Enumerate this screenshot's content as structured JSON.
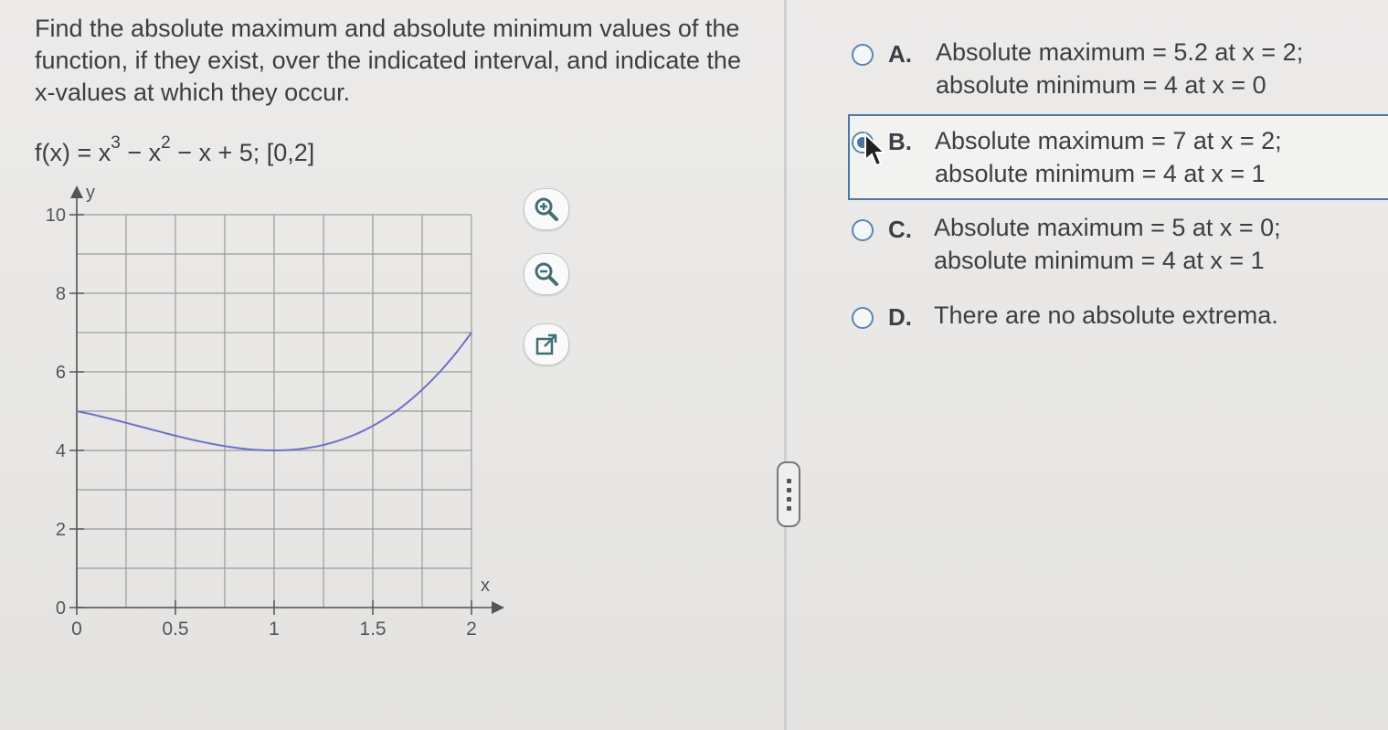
{
  "question": {
    "prompt": "Find the absolute maximum and absolute minimum values of the function, if they exist, over the indicated interval, and indicate the x-values at which they occur.",
    "formula_prefix": "f(x) = x",
    "formula_exp1": "3",
    "formula_mid": " − x",
    "formula_exp2": "2",
    "formula_suffix": " − x + 5; [0,2]"
  },
  "graph": {
    "y_axis_label": "y",
    "x_axis_label": "x",
    "y_ticks": [
      "10",
      "8",
      "6",
      "4",
      "2",
      "0"
    ],
    "x_ticks": [
      "0",
      "0.5",
      "1",
      "1.5",
      "2"
    ]
  },
  "chart_data": {
    "type": "line",
    "series": [
      {
        "function": "x^3 - x^2 - x + 5",
        "x": [
          0,
          0.25,
          0.5,
          0.75,
          1,
          1.25,
          1.5,
          1.75,
          2
        ],
        "y": [
          5,
          4.703,
          4.375,
          4.109,
          4,
          4.141,
          4.625,
          5.547,
          7
        ]
      }
    ],
    "xlim": [
      0,
      2
    ],
    "ylim": [
      0,
      10
    ],
    "grid": true,
    "xlabel": "x",
    "ylabel": "y",
    "line_color": "#6b72c8"
  },
  "tools": {
    "zoom_in_icon": "zoom-in-icon",
    "zoom_out_icon": "zoom-out-icon",
    "popout_icon": "external-link-icon"
  },
  "options": [
    {
      "letter": "A.",
      "line1": "Absolute maximum = 5.2 at x = 2;",
      "line2": "absolute minimum = 4 at x = 0",
      "selected": false
    },
    {
      "letter": "B.",
      "line1": "Absolute maximum = 7 at x = 2;",
      "line2": "absolute minimum = 4 at x = 1",
      "selected": true
    },
    {
      "letter": "C.",
      "line1": "Absolute maximum = 5 at x = 0;",
      "line2": "absolute minimum = 4 at x = 1",
      "selected": false
    },
    {
      "letter": "D.",
      "line1": "There are no absolute extrema.",
      "line2": "",
      "selected": false
    }
  ],
  "colors": {
    "accent": "#4b78a5",
    "curve": "#6b72c8",
    "text": "#3b3e44"
  }
}
